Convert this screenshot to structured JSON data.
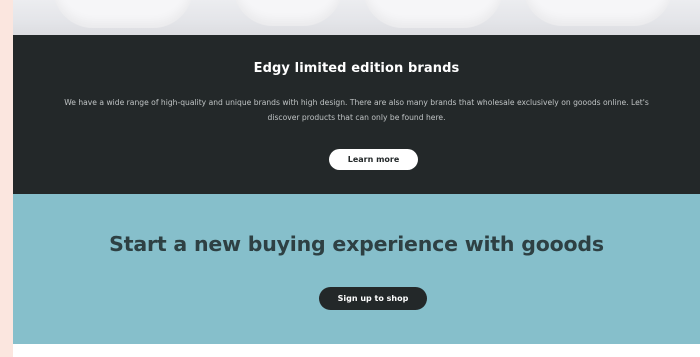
{
  "colors": {
    "outer_background": "#fbe6df",
    "dark_section": "#232829",
    "teal_section": "#86bfcb",
    "teal_heading": "#2e4043",
    "button_light": "#ffffff",
    "button_dark": "#232829"
  },
  "brands_section": {
    "title": "Edgy limited edition brands",
    "body": "We have a wide range of high-quality and unique brands with high design. There are also many brands that wholesale exclusively on gooods online. Let's discover products that can only be found here.",
    "cta_label": "Learn more"
  },
  "signup_section": {
    "title": "Start a new buying experience with gooods",
    "cta_label": "Sign up to shop"
  }
}
